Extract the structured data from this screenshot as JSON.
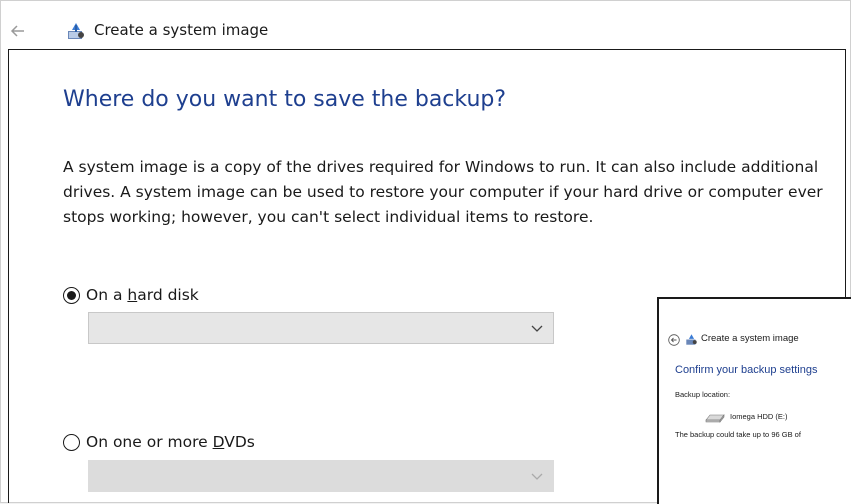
{
  "window": {
    "title": "Create a system image"
  },
  "page": {
    "heading": "Where do you want to save the backup?",
    "description": "A system image is a copy of the drives required for Windows to run. It can also include additional drives. A system image can be used to restore your computer if your hard drive or computer ever stops working; however, you can't select individual items to restore."
  },
  "options": {
    "hard_disk": {
      "prefix": "On a ",
      "accel": "h",
      "suffix": "ard disk",
      "selected": true,
      "dropdown_value": ""
    },
    "dvds": {
      "prefix": "On one or more ",
      "accel": "D",
      "suffix": "VDs",
      "selected": false,
      "dropdown_value": ""
    }
  },
  "inset": {
    "title": "Create a system image",
    "heading": "Confirm your backup settings",
    "backup_location_label": "Backup location:",
    "drive_name": "Iomega HDD (E:)",
    "size_note": "The backup could take up to 96 GB of"
  },
  "colors": {
    "heading": "#1e3f8f",
    "background": "#ffffff",
    "dropdown_bg": "#e6e6e6"
  },
  "icons": {
    "back": "back-arrow-icon",
    "app": "system-image-icon",
    "dropdown": "chevron-down-icon",
    "drive": "hard-drive-icon"
  }
}
